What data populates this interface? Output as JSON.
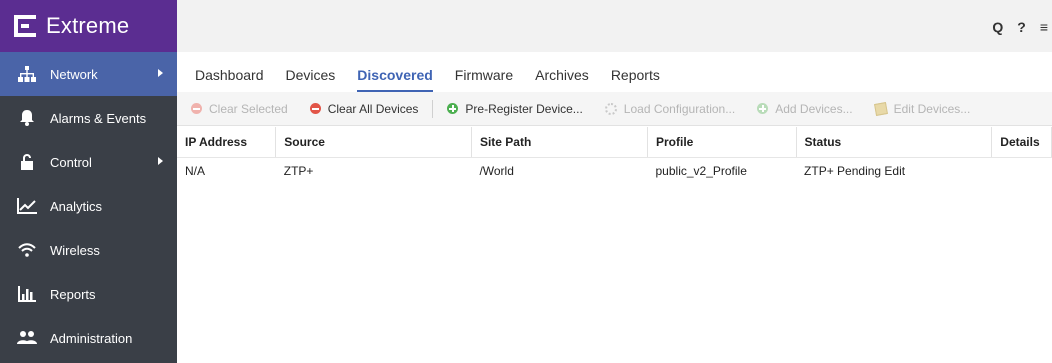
{
  "app": {
    "brand": "Extreme",
    "colors": {
      "brand_purple": "#5b2d91",
      "sidebar": "#3a3f47",
      "active_nav": "#4a64a8",
      "tab_active": "#3f64b4"
    }
  },
  "sidebar": {
    "items": [
      {
        "label": "Network",
        "icon": "network-icon",
        "active": true,
        "has_arrow": true
      },
      {
        "label": "Alarms & Events",
        "icon": "bell-icon",
        "active": false,
        "has_arrow": false
      },
      {
        "label": "Control",
        "icon": "lock-icon",
        "active": false,
        "has_arrow": true
      },
      {
        "label": "Analytics",
        "icon": "chart-icon",
        "active": false,
        "has_arrow": false
      },
      {
        "label": "Wireless",
        "icon": "wifi-icon",
        "active": false,
        "has_arrow": false
      },
      {
        "label": "Reports",
        "icon": "bar-chart-icon",
        "active": false,
        "has_arrow": false
      },
      {
        "label": "Administration",
        "icon": "users-icon",
        "active": false,
        "has_arrow": false
      }
    ]
  },
  "topbar": {
    "icons": [
      "search-icon",
      "help-icon",
      "menu-icon"
    ],
    "search_glyph": "Q",
    "help_glyph": "?",
    "menu_glyph": "≡"
  },
  "tabs": [
    {
      "label": "Dashboard",
      "active": false
    },
    {
      "label": "Devices",
      "active": false
    },
    {
      "label": "Discovered",
      "active": true
    },
    {
      "label": "Firmware",
      "active": false
    },
    {
      "label": "Archives",
      "active": false
    },
    {
      "label": "Reports",
      "active": false
    }
  ],
  "toolbar": {
    "clear_selected": "Clear Selected",
    "clear_all": "Clear All Devices",
    "pre_register": "Pre-Register Device...",
    "load_config": "Load Configuration...",
    "add_devices": "Add Devices...",
    "edit_devices": "Edit Devices..."
  },
  "table": {
    "columns": [
      "IP Address",
      "Source",
      "Site Path",
      "Profile",
      "Status",
      "Details"
    ],
    "rows": [
      [
        "N/A",
        "ZTP+",
        "/World",
        "public_v2_Profile",
        "ZTP+ Pending Edit",
        ""
      ]
    ]
  }
}
